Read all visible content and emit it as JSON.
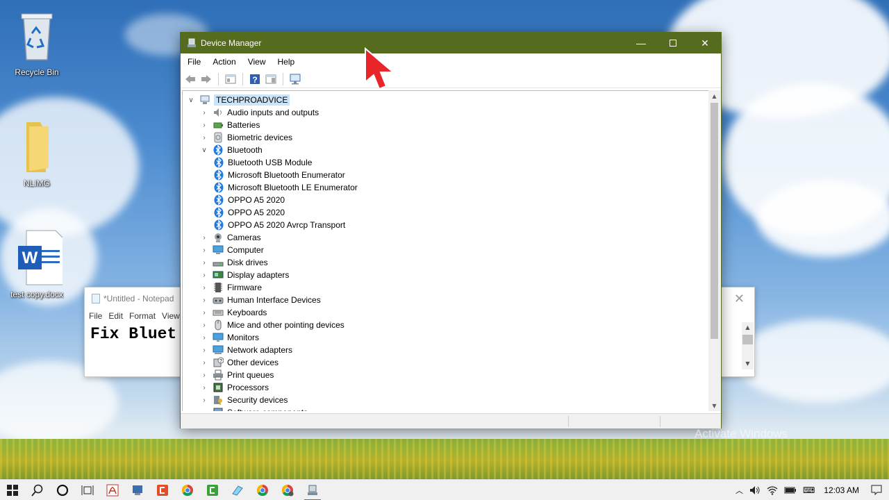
{
  "desktop": {
    "icons": [
      {
        "label": "Recycle Bin",
        "icon": "recycle-bin-icon"
      },
      {
        "label": "NLIMG",
        "icon": "folder-icon"
      },
      {
        "label": "test copy.docx",
        "icon": "word-document-icon"
      }
    ],
    "watermark": "Activate Windows"
  },
  "notepad": {
    "title": "*Untitled - Notepad",
    "menu": [
      "File",
      "Edit",
      "Format",
      "View"
    ],
    "text": "Fix Bluet"
  },
  "device_manager": {
    "title": "Device Manager",
    "accent_color": "#556b1e",
    "menu": [
      "File",
      "Action",
      "View",
      "Help"
    ],
    "root": "TECHPROADVICE",
    "tree": [
      {
        "label": "Audio inputs and outputs",
        "icon": "speaker-icon",
        "level": 1,
        "state": "collapsed"
      },
      {
        "label": "Batteries",
        "icon": "battery-icon",
        "level": 1,
        "state": "collapsed"
      },
      {
        "label": "Biometric devices",
        "icon": "fingerprint-icon",
        "level": 1,
        "state": "collapsed"
      },
      {
        "label": "Bluetooth",
        "icon": "bluetooth-icon",
        "level": 1,
        "state": "expanded"
      },
      {
        "label": "Bluetooth USB Module",
        "icon": "bluetooth-icon",
        "level": 2,
        "state": "leaf"
      },
      {
        "label": "Microsoft Bluetooth Enumerator",
        "icon": "bluetooth-icon",
        "level": 2,
        "state": "leaf"
      },
      {
        "label": "Microsoft Bluetooth LE Enumerator",
        "icon": "bluetooth-icon",
        "level": 2,
        "state": "leaf"
      },
      {
        "label": "OPPO A5 2020",
        "icon": "bluetooth-icon",
        "level": 2,
        "state": "leaf"
      },
      {
        "label": "OPPO A5 2020",
        "icon": "bluetooth-icon",
        "level": 2,
        "state": "leaf"
      },
      {
        "label": "OPPO A5 2020 Avrcp Transport",
        "icon": "bluetooth-icon",
        "level": 2,
        "state": "leaf"
      },
      {
        "label": "Cameras",
        "icon": "camera-icon",
        "level": 1,
        "state": "collapsed"
      },
      {
        "label": "Computer",
        "icon": "computer-icon",
        "level": 1,
        "state": "collapsed"
      },
      {
        "label": "Disk drives",
        "icon": "disk-drive-icon",
        "level": 1,
        "state": "collapsed"
      },
      {
        "label": "Display adapters",
        "icon": "display-adapter-icon",
        "level": 1,
        "state": "collapsed"
      },
      {
        "label": "Firmware",
        "icon": "firmware-icon",
        "level": 1,
        "state": "collapsed"
      },
      {
        "label": "Human Interface Devices",
        "icon": "hid-icon",
        "level": 1,
        "state": "collapsed"
      },
      {
        "label": "Keyboards",
        "icon": "keyboard-icon",
        "level": 1,
        "state": "collapsed"
      },
      {
        "label": "Mice and other pointing devices",
        "icon": "mouse-icon",
        "level": 1,
        "state": "collapsed"
      },
      {
        "label": "Monitors",
        "icon": "monitor-icon",
        "level": 1,
        "state": "collapsed"
      },
      {
        "label": "Network adapters",
        "icon": "network-adapter-icon",
        "level": 1,
        "state": "collapsed"
      },
      {
        "label": "Other devices",
        "icon": "unknown-device-icon",
        "level": 1,
        "state": "collapsed"
      },
      {
        "label": "Print queues",
        "icon": "printer-icon",
        "level": 1,
        "state": "collapsed"
      },
      {
        "label": "Processors",
        "icon": "processor-icon",
        "level": 1,
        "state": "collapsed"
      },
      {
        "label": "Security devices",
        "icon": "security-device-icon",
        "level": 1,
        "state": "collapsed"
      },
      {
        "label": "Software components",
        "icon": "software-component-icon",
        "level": 1,
        "state": "collapsed"
      }
    ]
  },
  "taskbar": {
    "apps": [
      "start",
      "search",
      "cortana",
      "task-view",
      "acrobat",
      "media-player",
      "camtasia",
      "chrome",
      "camtasia-recorder",
      "paint",
      "chrome",
      "chrome-profile",
      "device-manager"
    ],
    "time": "12:03 AM"
  }
}
